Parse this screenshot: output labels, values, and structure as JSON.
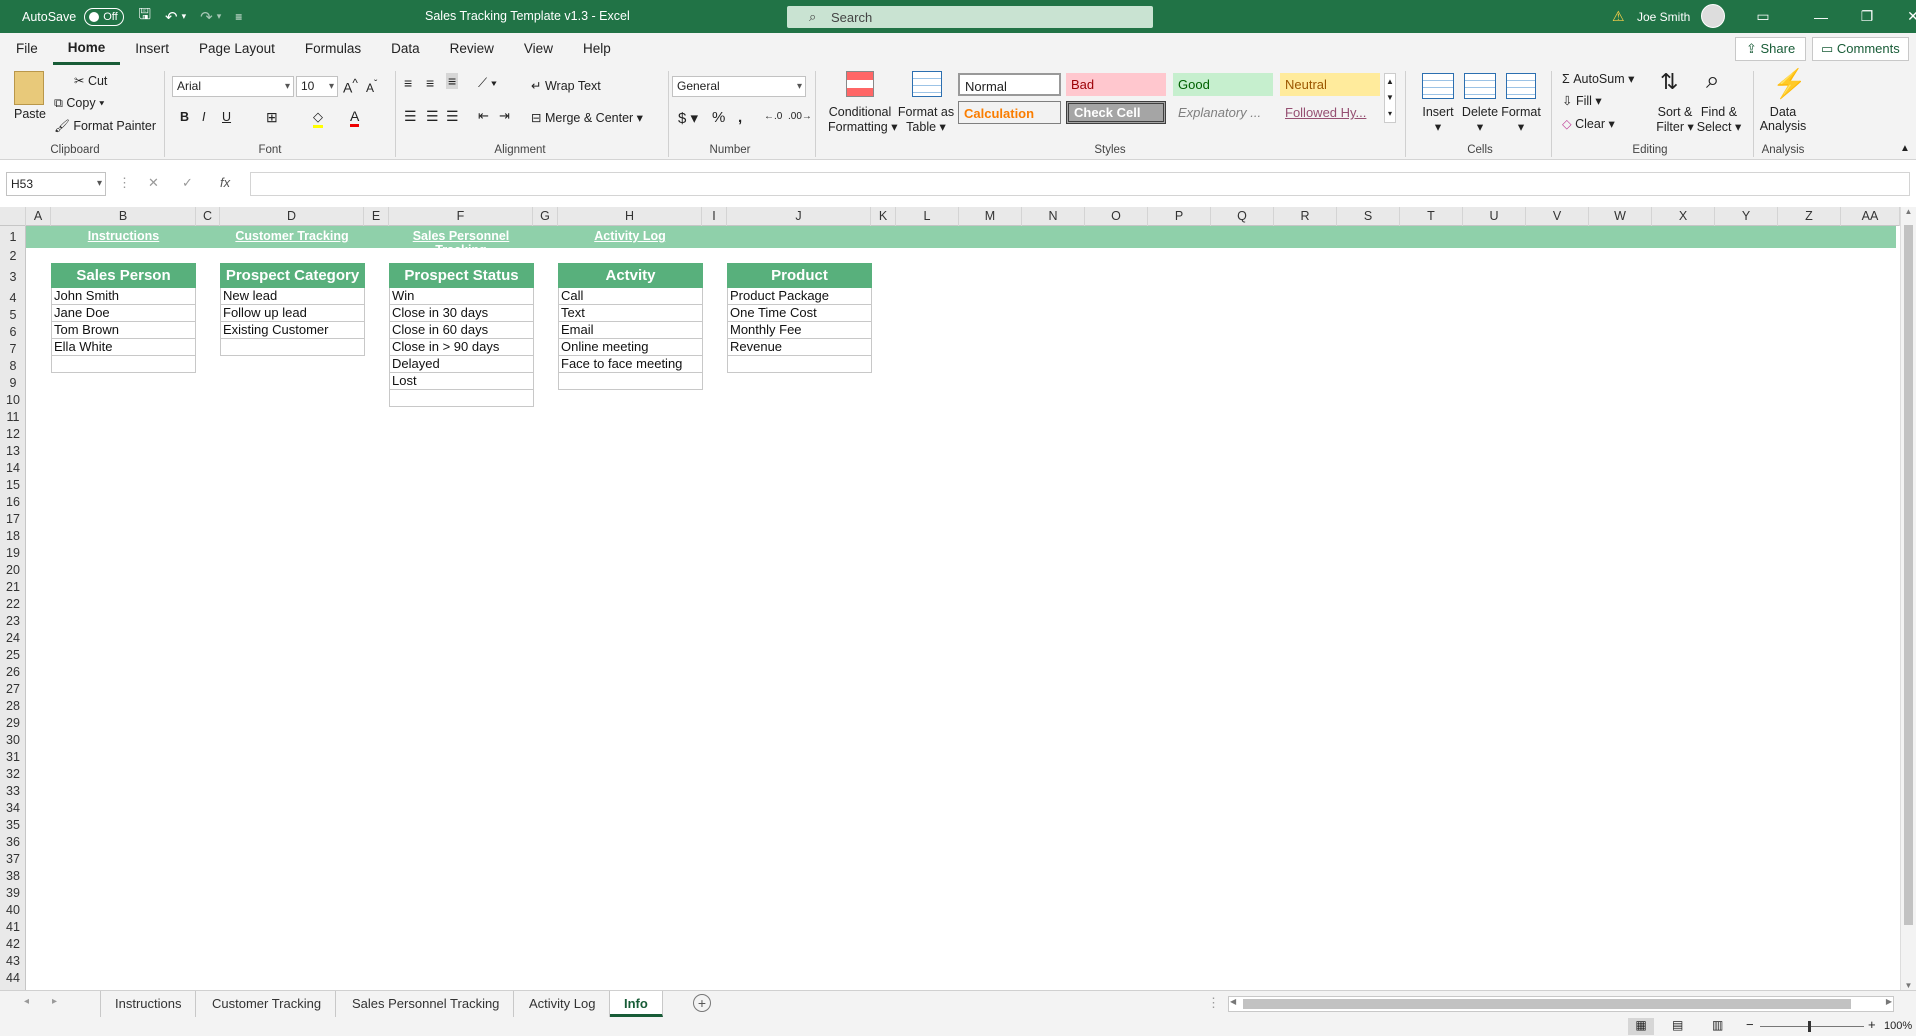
{
  "titlebar": {
    "autosave_label": "AutoSave",
    "autosave_state": "Off",
    "doc_title": "Sales Tracking Template v1.3  -  Excel",
    "search_placeholder": "Search",
    "user_name": "Joe Smith"
  },
  "menu": {
    "items": [
      "File",
      "Home",
      "Insert",
      "Page Layout",
      "Formulas",
      "Data",
      "Review",
      "View",
      "Help"
    ],
    "active": "Home",
    "share_label": "Share",
    "comments_label": "Comments"
  },
  "ribbon": {
    "clipboard": {
      "paste": "Paste",
      "cut": "Cut",
      "copy": "Copy",
      "format_painter": "Format Painter",
      "label": "Clipboard"
    },
    "font": {
      "name": "Arial",
      "size": "10",
      "label": "Font"
    },
    "alignment": {
      "wrap_text": "Wrap Text",
      "merge_center": "Merge & Center",
      "label": "Alignment"
    },
    "number": {
      "format": "General",
      "label": "Number"
    },
    "styles": {
      "conditional_1": "Conditional",
      "conditional_2": "Formatting",
      "format_table_1": "Format as",
      "format_table_2": "Table",
      "normal": "Normal",
      "bad": "Bad",
      "good": "Good",
      "neutral": "Neutral",
      "calculation": "Calculation",
      "check_cell": "Check Cell",
      "explanatory": "Explanatory ...",
      "followed": "Followed Hy...",
      "label": "Styles"
    },
    "cells": {
      "insert": "Insert",
      "delete": "Delete",
      "format": "Format",
      "label": "Cells"
    },
    "editing": {
      "autosum": "AutoSum",
      "fill": "Fill",
      "clear": "Clear",
      "sort_1": "Sort &",
      "sort_2": "Filter",
      "find_1": "Find &",
      "find_2": "Select",
      "label": "Editing"
    },
    "analysis": {
      "data_1": "Data",
      "data_2": "Analysis",
      "label": "Analysis"
    }
  },
  "formula_bar": {
    "name_box": "H53",
    "fx": "fx",
    "value": ""
  },
  "columns": [
    "A",
    "B",
    "C",
    "D",
    "E",
    "F",
    "G",
    "H",
    "I",
    "J",
    "K",
    "L",
    "M",
    "N",
    "O",
    "P",
    "Q",
    "R",
    "S",
    "T",
    "U",
    "V",
    "W",
    "X",
    "Y",
    "Z",
    "AA"
  ],
  "rows": [
    "1",
    "2",
    "3",
    "4",
    "5",
    "6",
    "7",
    "8",
    "9",
    "10",
    "11",
    "12",
    "13",
    "14",
    "15",
    "16",
    "17",
    "18",
    "19",
    "20",
    "21",
    "22",
    "23",
    "24",
    "25",
    "26",
    "27",
    "28",
    "29",
    "30",
    "31",
    "32",
    "33",
    "34",
    "35",
    "36",
    "37",
    "38",
    "39",
    "40",
    "41",
    "42",
    "43",
    "44"
  ],
  "nav_links": [
    "Instructions",
    "Customer Tracking",
    "Sales Personnel Tracking",
    "Activity Log"
  ],
  "tables": [
    {
      "header": "Sales Person",
      "items": [
        "John Smith",
        "Jane Doe",
        "Tom Brown",
        "Ella White",
        ""
      ]
    },
    {
      "header": "Prospect Category",
      "items": [
        "New lead",
        "Follow up lead",
        "Existing Customer",
        ""
      ]
    },
    {
      "header": "Prospect Status",
      "items": [
        "Win",
        "Close in 30 days",
        "Close in 60 days",
        "Close in > 90 days",
        "Delayed",
        "Lost",
        ""
      ]
    },
    {
      "header": "Actvity",
      "items": [
        "Call",
        "Text",
        "Email",
        "Online meeting",
        "Face to face meeting",
        ""
      ]
    },
    {
      "header": "Product",
      "items": [
        "Product Package",
        "One Time Cost",
        "Monthly Fee",
        "Revenue",
        ""
      ]
    }
  ],
  "sheet_tabs": [
    "Instructions",
    "Customer Tracking",
    "Sales Personnel Tracking",
    "Activity Log",
    "Info"
  ],
  "active_sheet": "Info",
  "status": {
    "zoom": "100%"
  },
  "colors": {
    "excel_green": "#217346",
    "header_green": "#58b07c",
    "nav_green": "#8fd0aa"
  }
}
